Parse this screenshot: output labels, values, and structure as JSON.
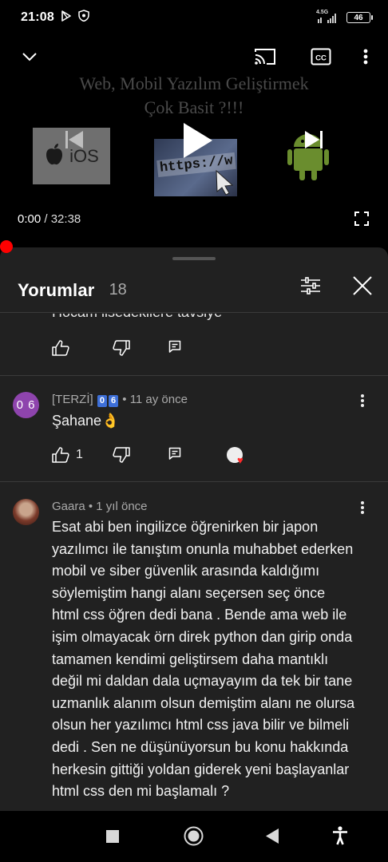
{
  "status_bar": {
    "time": "21:08",
    "network_label": "4.5G",
    "battery": "46"
  },
  "player": {
    "title_line1": "Web, Mobil Yazılım Geliştirmek",
    "title_line2": "Çok Basit ?!!!",
    "thumb_ios_label": "iOS",
    "thumb_web_label": "https://w",
    "time_current": "0:00",
    "time_separator": " / ",
    "time_total": "32:38",
    "progress": 0
  },
  "comments_sheet": {
    "title": "Yorumlar",
    "count": "18",
    "clipped_comment": "Hocam lisedekilere tavsiye",
    "comments": [
      {
        "avatar_text": "0 6",
        "author": "[TERZİ]",
        "badge1": "0",
        "badge2": "6",
        "time": "11 ay önce",
        "text": "Şahane👌",
        "likes": "1"
      },
      {
        "author": "Gaara",
        "time": "1 yıl önce",
        "text_lines": [
          "Esat abi ben ingilizce öğrenirken bir japon",
          "yazılımcı ile tanıştım onunla muhabbet ederken",
          "mobil ve siber güvenlik arasında kaldığımı",
          "söylemiştim hangi alanı seçersen seç önce",
          "html css öğren dedi bana . Bende ama web ile",
          "işim olmayacak örn direk python dan girip onda",
          "tamamen kendimi geliştirsem daha mantıklı",
          "değil mi daldan dala uçmayayım da tek bir tane",
          "uzmanlık alanım olsun demiştim alanı ne olursa",
          "olsun her yazılımcı html css java bilir ve bilmeli",
          "dedi . Sen ne düşünüyorsun bu konu hakkında",
          "herkesin gittiği yoldan giderek yeni başlayanlar",
          "html css den mi başlamalı ?"
        ]
      }
    ]
  },
  "colors": {
    "sheet_bg": "#212121",
    "accent_red": "#ff0000",
    "meta_text": "#aaaaaa"
  },
  "icons": {
    "status": [
      "play-store-icon",
      "shield-icon",
      "signal-icon",
      "battery-icon"
    ],
    "player": [
      "chevron-down-icon",
      "cast-icon",
      "cc-icon",
      "more-vert-icon",
      "play-icon",
      "skip-previous-icon",
      "skip-next-icon",
      "fullscreen-icon"
    ],
    "sheet": [
      "filter-sliders-icon",
      "close-icon",
      "thumb-up-icon",
      "thumb-down-icon",
      "reply-icon"
    ],
    "nav": [
      "square-icon",
      "circle-icon",
      "back-triangle-icon",
      "accessibility-icon"
    ]
  }
}
